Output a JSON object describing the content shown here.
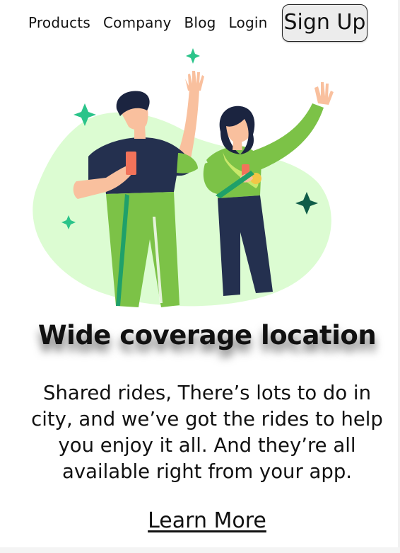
{
  "nav": {
    "items": [
      {
        "label": "Products"
      },
      {
        "label": "Company"
      },
      {
        "label": "Blog"
      },
      {
        "label": "Login"
      }
    ],
    "signup_label": "Sign Up"
  },
  "hero": {
    "illustration_icon": "two-people-waving-phones-illustration",
    "headline": "Wide coverage location",
    "body": "Shared rides, There’s lots to do in city, and we’ve got the rides to help you enjoy it all. And they’re all available right from your app.",
    "cta_label": "Learn More"
  },
  "colors": {
    "blob": "#dcfcd2",
    "sparkle_light": "#2bc48a",
    "sparkle_dark": "#0f5c48",
    "shirt_navy": "#24304f",
    "green": "#7cc247",
    "skin": "#f9c09e"
  }
}
